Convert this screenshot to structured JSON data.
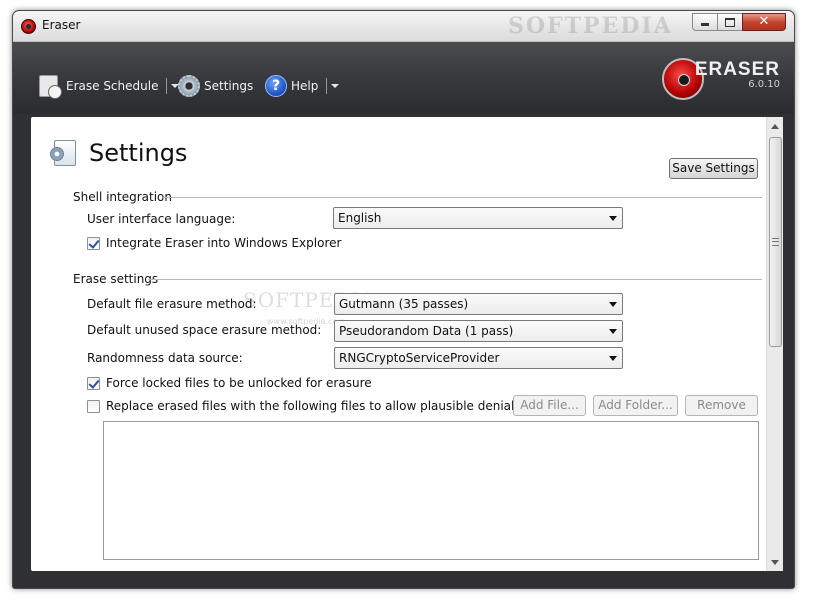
{
  "window": {
    "title": "Eraser",
    "watermark": "SOFTPEDIA"
  },
  "toolbar": {
    "erase_schedule": "Erase Schedule",
    "settings": "Settings",
    "help": "Help",
    "help_glyph": "?"
  },
  "brand": {
    "name": "ERASER",
    "version": "6.0.10"
  },
  "page": {
    "title": "Settings",
    "save_button": "Save Settings"
  },
  "shell": {
    "group_label": "Shell integration",
    "ui_language_label": "User interface language:",
    "ui_language_value": "English",
    "integrate_label": "Integrate Eraser into Windows Explorer",
    "integrate_checked": true
  },
  "erase": {
    "group_label": "Erase settings",
    "file_method_label": "Default file erasure method:",
    "file_method_value": "Gutmann (35 passes)",
    "unused_method_label": "Default unused space erasure method:",
    "unused_method_value": "Pseudorandom Data (1 pass)",
    "random_source_label": "Randomness data source:",
    "random_source_value": "RNGCryptoServiceProvider",
    "force_unlock_label": "Force locked files to be unlocked for erasure",
    "force_unlock_checked": true,
    "replace_label": "Replace erased files with the following files to allow plausible deniability",
    "replace_checked": false,
    "add_file": "Add File...",
    "add_folder": "Add Folder...",
    "remove": "Remove",
    "files": []
  },
  "content_watermark": {
    "big": "SOFTPEDIA",
    "small": "www.softpedia.com"
  },
  "colors": {
    "toolbar_bg": "#2f3033",
    "close_button": "#c4452f",
    "logo_red": "#b00000",
    "check_mark": "#2f4f9f"
  }
}
